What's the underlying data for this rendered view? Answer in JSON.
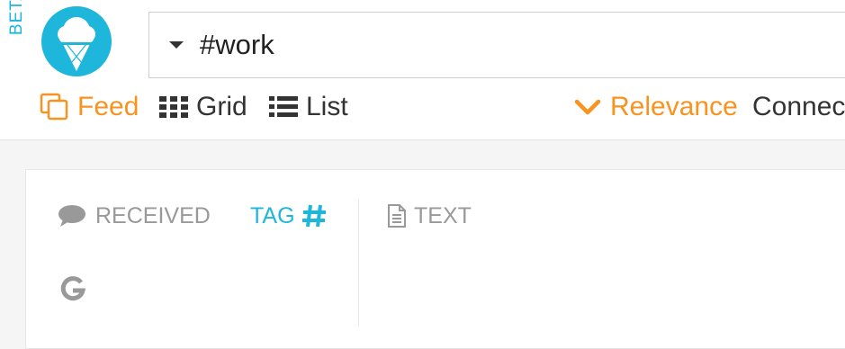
{
  "app": {
    "beta_label": "BETA",
    "brand_color": "#1fb6dc",
    "accent_color": "#f7931e"
  },
  "search": {
    "value": "#work"
  },
  "views": [
    {
      "label": "Feed",
      "icon": "feed-icon",
      "active": true
    },
    {
      "label": "Grid",
      "icon": "grid-icon",
      "active": false
    },
    {
      "label": "List",
      "icon": "list-icon",
      "active": false
    }
  ],
  "sort": {
    "label": "Relevance",
    "icon": "chevron-down-icon",
    "next_label": "Connec"
  },
  "filters": {
    "received_label": "RECEIVED",
    "tag_label": "TAG",
    "text_label": "TEXT"
  }
}
